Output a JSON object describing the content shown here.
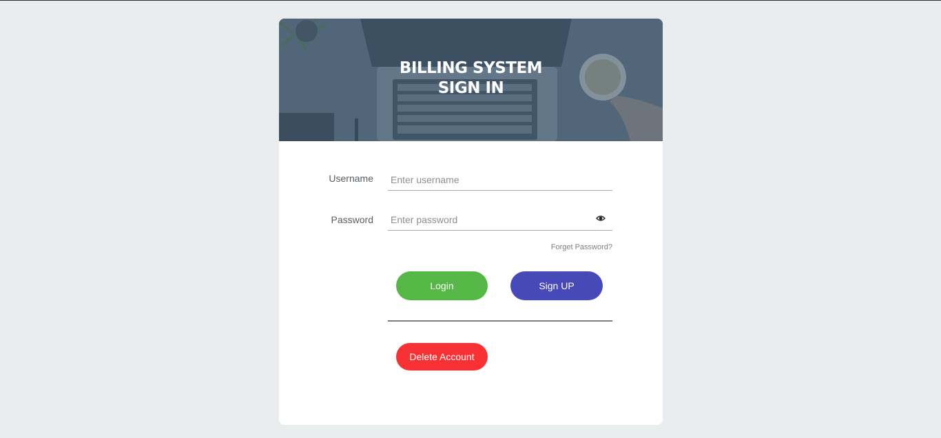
{
  "banner": {
    "title_line1": "BILLING SYSTEM",
    "title_line2": "SIGN IN"
  },
  "form": {
    "username_label": "Username",
    "username_placeholder": "Enter username",
    "username_value": "",
    "password_label": "Password",
    "password_placeholder": "Enter password",
    "password_value": "",
    "forget_password_label": "Forget Password?",
    "show_password_icon": "eye-icon"
  },
  "buttons": {
    "login_label": "Login",
    "signup_label": "Sign UP",
    "delete_label": "Delete Account"
  },
  "colors": {
    "page_background": "#e9edee",
    "login_button": "#55b745",
    "signup_button": "#4749b9",
    "delete_button": "#f83234"
  }
}
